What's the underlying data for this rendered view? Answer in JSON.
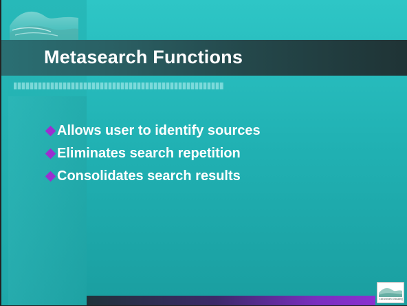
{
  "slide": {
    "title": "Metasearch Functions",
    "bullets": [
      {
        "text": "Allows user to identify sources"
      },
      {
        "text": "Eliminates search repetition"
      },
      {
        "text": "Consolidates search results"
      }
    ]
  },
  "logo": {
    "text": "Informed Strategies"
  },
  "colors": {
    "background": "#21b2b4",
    "title_bar": "#2a5e62",
    "bullet_marker": "#9b2fd0",
    "text": "#ffffff"
  },
  "icons": {
    "bullet": "diamond-icon",
    "corner": "landscape-hills-icon",
    "brand": "informed-strategies-logo-icon"
  }
}
